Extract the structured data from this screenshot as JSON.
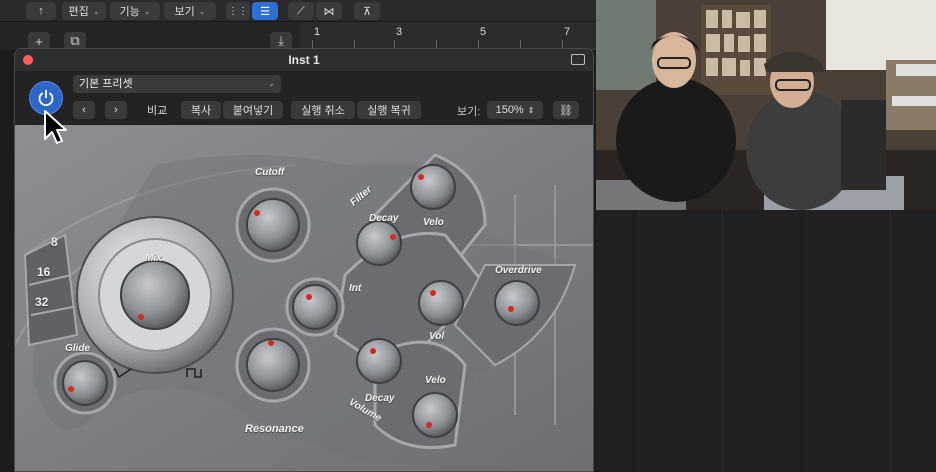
{
  "toolbar": {
    "edit_label": "편집",
    "functions_label": "기능",
    "view_label": "보기"
  },
  "ruler": {
    "marks": [
      "1",
      "3",
      "5",
      "7"
    ]
  },
  "plugin": {
    "title": "Inst 1",
    "preset": "기본 프리셋",
    "compare_label": "비교",
    "copy_label": "복사",
    "paste_label": "붙여넣기",
    "undo_label": "실행 취소",
    "redo_label": "실행 복귀",
    "view_label": "보기:",
    "zoom": "150%"
  },
  "synth": {
    "cutoff": "Cutoff",
    "filter": "Filter",
    "decay": "Decay",
    "velo": "Velo",
    "mix": "Mix",
    "int": "Int",
    "overdrive": "Overdrive",
    "vol": "Vol",
    "glide": "Glide",
    "resonance": "Resonance",
    "volume": "Volume",
    "octaves": [
      "8",
      "16",
      "32"
    ]
  },
  "colors": {
    "accent": "#2d66c9",
    "close": "#ff5f57",
    "knob_dot": "#d42a1f"
  }
}
